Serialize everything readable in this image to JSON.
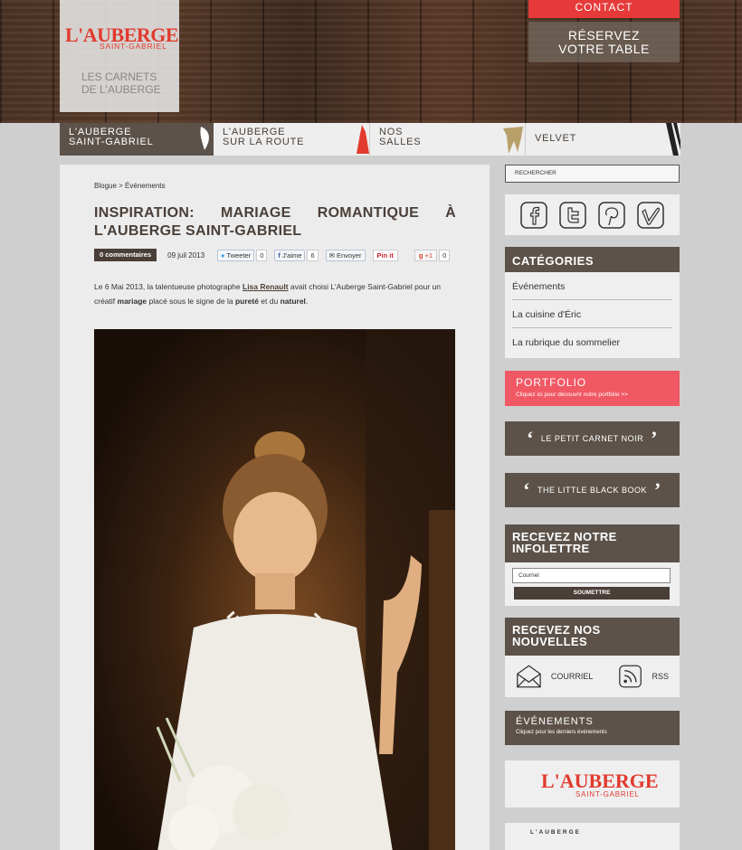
{
  "header": {
    "logo_text": "L'AUBERGE",
    "logo_sub": "SAINT-GABRIEL",
    "tagline_1": "LES CARNETS",
    "tagline_2": "DE L'AUBERGE",
    "contact_label": "CONTACT",
    "reserve_line1": "RÉSERVEZ",
    "reserve_line2": "VOTRE TABLE"
  },
  "nav": [
    {
      "line1": "L'AUBERGE",
      "line2": "SAINT-GABRIEL"
    },
    {
      "line1": "L'AUBERGE",
      "line2": "SUR LA ROUTE"
    },
    {
      "line1": "NOS",
      "line2": "SALLES"
    },
    {
      "line1": "VELVET",
      "line2": ""
    }
  ],
  "article": {
    "breadcrumb": "Blogue > Événements",
    "title_line1": "INSPIRATION: MARIAGE ROMANTIQUE À",
    "title_line2": "L'AUBERGE SAINT-GABRIEL",
    "comments": "0 commentaires",
    "date": "09 juil 2013",
    "tweet_label": "Tweeter",
    "tweet_count": "0",
    "like_label": "J'aime",
    "like_count": "6",
    "send_label": "Envoyer",
    "pin_label": "Pin it",
    "gplus_label": "+1",
    "gplus_count": "0",
    "intro_a": "Le 6 Mai 2013, la talentueuse photographe ",
    "intro_link": "Lisa Renault",
    "intro_b": " avait choisi L'Auberge Saint-Gabriel pour un créatif ",
    "intro_bold1": "mariage",
    "intro_c": " placé sous le signe de la ",
    "intro_bold2": "pureté",
    "intro_d": " et du ",
    "intro_bold3": "naturel",
    "intro_e": "."
  },
  "sidebar": {
    "search_placeholder": "RECHERCHER",
    "social_icons": [
      "facebook-icon",
      "twitter-icon",
      "pinterest-icon",
      "vimeo-icon"
    ],
    "categories_title": "CATÉGORIES",
    "categories": [
      "Événements",
      "La cuisine d'Éric",
      "La rubrique du sommelier"
    ],
    "portfolio_title": "PORTFOLIO",
    "portfolio_sub": "Cliquez ici pour découvrir notre portfolio >>",
    "carnet_label": "LE PETIT CARNET NOIR",
    "lbb_label": "THE LITTLE BLACK BOOK",
    "infolettre_line1": "RECEVEZ NOTRE",
    "infolettre_line2": "INFOLETTRE",
    "email_placeholder": "Courriel",
    "submit_label": "SOUMETTRE",
    "news_line1": "RECEVEZ NOS",
    "news_line2": "NOUVELLES",
    "email_label": "COURRIEL",
    "rss_label": "RSS",
    "events_title": "ÉVÉNEMENTS",
    "events_sub": "Cliquez pour les derniers événements",
    "logo_text": "L'AUBERGE",
    "logo_sub": "SAINT-GABRIEL",
    "bottom_label": "L'AUBERGE"
  },
  "colors": {
    "brand_red": "#e23a2e",
    "dark_brown": "#5c524a",
    "portfolio_pink": "#f05864"
  }
}
